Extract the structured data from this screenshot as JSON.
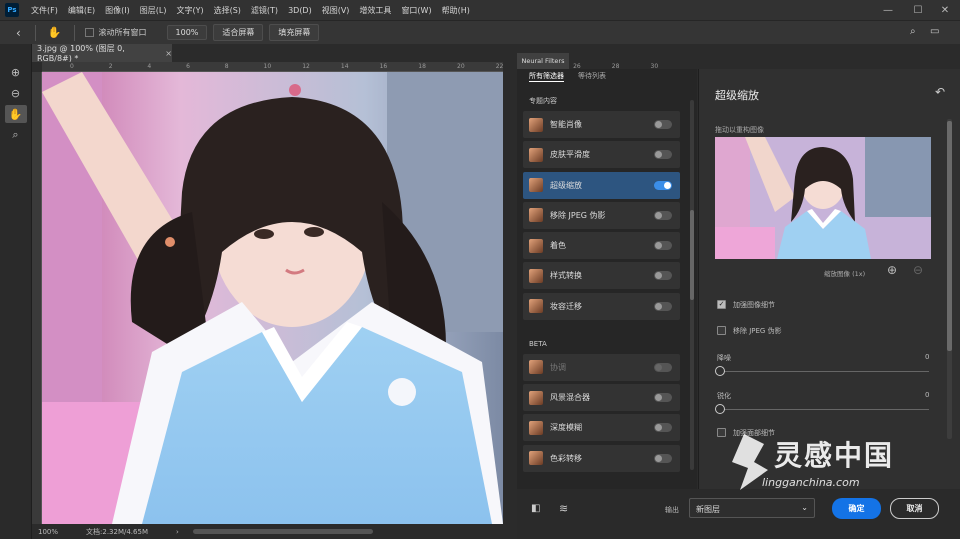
{
  "app": {
    "logo": "Ps"
  },
  "menu": [
    "文件(F)",
    "编辑(E)",
    "图像(I)",
    "图层(L)",
    "文字(Y)",
    "选择(S)",
    "滤镜(T)",
    "3D(D)",
    "视图(V)",
    "增效工具",
    "窗口(W)",
    "帮助(H)"
  ],
  "window_controls": {
    "minimize": "—",
    "maximize": "☐",
    "close": "✕"
  },
  "options": {
    "scroll_all": "滚动所有窗口",
    "zoom": "100%",
    "fit_screen": "适合屏幕",
    "fill_screen": "填充屏幕"
  },
  "document": {
    "tab_title": "3.jpg @ 100% (图层 0, RGB/8#) *",
    "close": "×"
  },
  "ruler": {
    "ticks": [
      "0",
      "2",
      "4",
      "6",
      "8",
      "10",
      "12",
      "14",
      "16",
      "18",
      "20",
      "22",
      "24",
      "26",
      "28",
      "30"
    ]
  },
  "status": {
    "zoom": "100%",
    "doc_info": "文档:2.32M/4.65M"
  },
  "panel": {
    "tab_label": "Neural Filters",
    "tabs": [
      "所有筛选器",
      "等待列表"
    ],
    "section_featured": "专题内容",
    "featured": [
      {
        "label": "智能肖像",
        "on": false
      },
      {
        "label": "皮肤平滑度",
        "on": false
      },
      {
        "label": "超级缩放",
        "on": true
      },
      {
        "label": "移除 JPEG 伪影",
        "on": false
      },
      {
        "label": "着色",
        "on": false
      },
      {
        "label": "样式转换",
        "on": false
      },
      {
        "label": "妆容迁移",
        "on": false
      }
    ],
    "section_beta": "BETA",
    "beta": [
      {
        "label": "协调",
        "on": false
      },
      {
        "label": "风景混合器",
        "on": false
      },
      {
        "label": "深度模糊",
        "on": false
      },
      {
        "label": "色彩转移",
        "on": false
      }
    ]
  },
  "settings": {
    "title": "超级缩放",
    "reset_icon": "reset-icon",
    "drag_hint": "拖动以重构图像",
    "zoom_label": "缩放图像 (1x)",
    "enhance_detail": "加强图像细节",
    "enhance_checked": true,
    "remove_jpeg": "移除 JPEG 伪影",
    "remove_checked": false,
    "noise_label": "降噪",
    "noise_value": "0",
    "sharpen_label": "锐化",
    "sharpen_value": "0",
    "face_detail": "加强面部细节",
    "face_checked": false
  },
  "output": {
    "label": "输出",
    "value": "新图层",
    "ok": "确定",
    "cancel": "取消"
  },
  "watermark": {
    "title": "灵感中国",
    "url": "lingganchina.com"
  },
  "colors": {
    "accent": "#1473e6",
    "selected_row": "#2d5580",
    "toggle_on": "#3b8ee8"
  }
}
